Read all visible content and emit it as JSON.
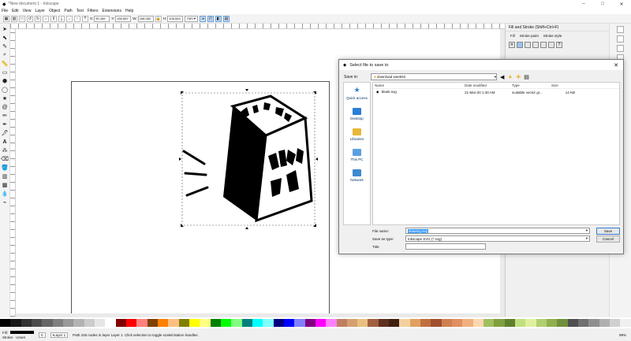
{
  "window": {
    "title": "*New document 1 - Inkscape"
  },
  "menu": [
    "File",
    "Edit",
    "View",
    "Layer",
    "Object",
    "Path",
    "Text",
    "Filters",
    "Extensions",
    "Help"
  ],
  "toolcontrols": {
    "x_label": "X:",
    "x_value": "90.159",
    "y_label": "Y:",
    "y_value": "150.657",
    "w_label": "W:",
    "w_value": "106.052",
    "h_label": "H:",
    "h_value": "105.543",
    "unit": "mm"
  },
  "panel": {
    "title": "Fill and Stroke (Shift+Ctrl+F)",
    "tabs": [
      "Fill",
      "Stroke paint",
      "Stroke style"
    ]
  },
  "dialog": {
    "title": "Select file to save to",
    "save_in_label": "Save in:",
    "save_in_value": "download week03",
    "places": [
      "Quick access",
      "Desktop",
      "Libraries",
      "This PC",
      "Network"
    ],
    "columns": [
      "Name",
      "Date modified",
      "Type",
      "Size"
    ],
    "files": [
      {
        "name": "blank.svg",
        "date": "21-Mar-20 1:40 AM",
        "type": "scalable vector gr...",
        "size": "14 KB"
      }
    ],
    "file_name_label": "File name:",
    "file_name_value": "drawing.svg",
    "save_type_label": "Save as type:",
    "save_type_value": "Inkscape SVG (*.svg)",
    "title_label": "Title:",
    "save_button": "Save",
    "cancel_button": "Cancel"
  },
  "status": {
    "fill_label": "Fill:",
    "stroke_label": "Stroke:",
    "stroke_value": "Unset",
    "opacity": "0",
    "layer": "•Layer 1",
    "message": "Path 245 nodes in layer Layer 1. Click selection to toggle scale/rotation handles.",
    "zoom": "99%"
  },
  "colors": {
    "accent": "#3399ff",
    "dialog_bg": "#f0f0f0"
  }
}
